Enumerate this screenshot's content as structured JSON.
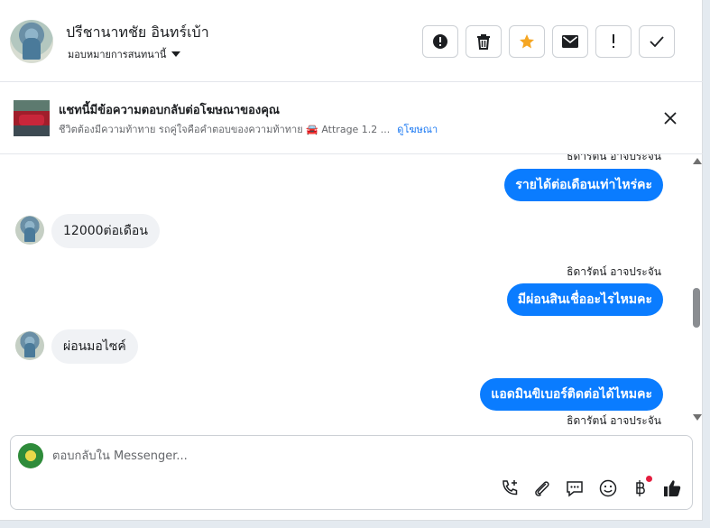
{
  "header": {
    "contact_name": "ปรีชานาทชัย อินทร์เบ้า",
    "assign_label": "มอบหมายการสนทนานี้",
    "actions": [
      "alert-circle",
      "trash",
      "star",
      "envelope",
      "exclamation",
      "check"
    ],
    "star_color": "#f5a623"
  },
  "ad": {
    "title": "แชทนี้มีข้อความตอบกลับต่อโฆษณาของคุณ",
    "subtitle": "ชีวิตต้องมีความท้าทาย รถคู่ใจคือคำตอบของความท้าทาย 🚘 Attrage 1.2 ...",
    "link": "ดูโฆษณา"
  },
  "messages": [
    {
      "type": "out",
      "sender": "ธิดารัตน์ อาจประจัน",
      "text": "รายได้ต่อเดือนเท่าไหร่คะ"
    },
    {
      "type": "in",
      "text": "12000ต่อเดือน"
    },
    {
      "type": "out",
      "sender": "ธิดารัตน์ อาจประจัน",
      "text": "มีผ่อนสินเชื่ออะไรไหมคะ"
    },
    {
      "type": "in",
      "text": "ผ่อนมอไซค์"
    },
    {
      "type": "out",
      "sender": "ธิดารัตน์ อาจประจัน",
      "text": "แอดมินขิเบอร์ติดต่อได้ไหมคะ"
    }
  ],
  "composer": {
    "placeholder": "ตอบกลับใน Messenger...",
    "tools": [
      "call-add",
      "paperclip",
      "chat-bubble",
      "emoji",
      "baht",
      "thumbs-up"
    ]
  },
  "colors": {
    "outgoing_bubble": "#0a7cff",
    "incoming_bubble": "#f0f2f5",
    "link": "#1877f2"
  }
}
